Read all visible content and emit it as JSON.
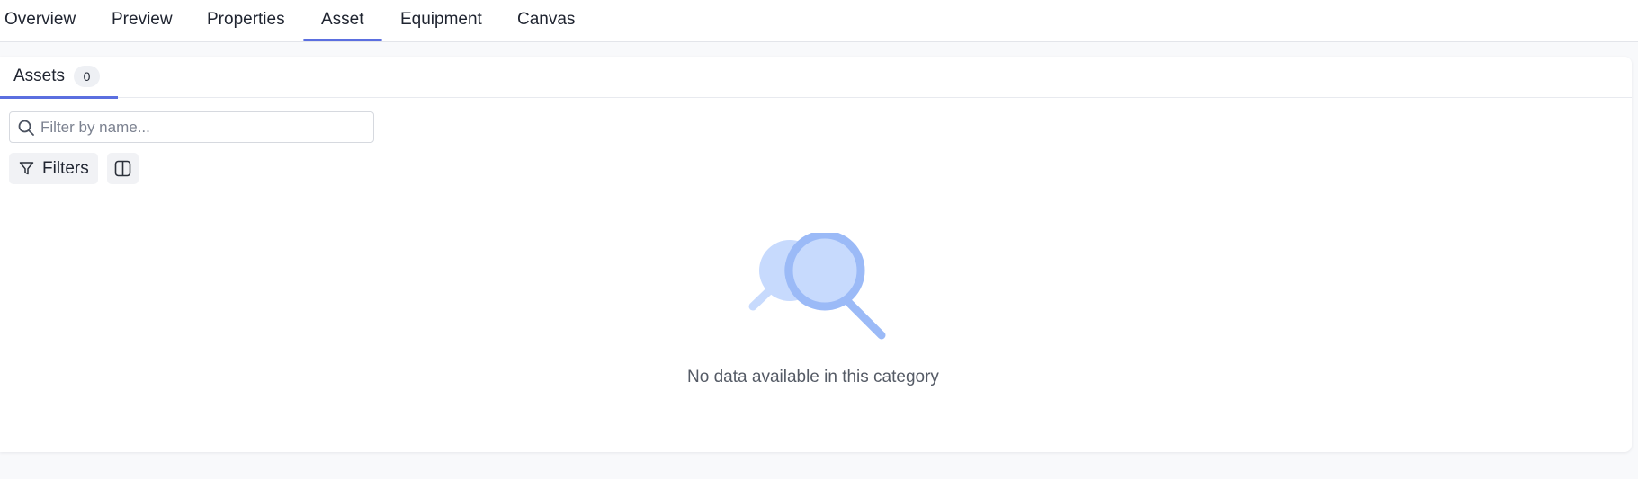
{
  "top_tabs": [
    {
      "label": "Overview"
    },
    {
      "label": "Preview"
    },
    {
      "label": "Properties"
    },
    {
      "label": "Asset",
      "active": true
    },
    {
      "label": "Equipment"
    },
    {
      "label": "Canvas"
    }
  ],
  "sub_tabs": [
    {
      "label": "Assets",
      "count": "0",
      "active": true
    }
  ],
  "search": {
    "placeholder": "Filter by name...",
    "value": "",
    "icon": "search-icon"
  },
  "toolbar": {
    "filters_label": "Filters",
    "filters_icon": "funnel-icon",
    "columns_icon": "columns-icon"
  },
  "empty_state": {
    "message": "No data available in this category",
    "icon": "magnifier-illustration",
    "colors": {
      "light": "#c7dafd",
      "mid": "#9bbaf7"
    }
  },
  "colors": {
    "accent": "#5b6fe0",
    "background": "#f8f9fb",
    "panel": "#ffffff"
  }
}
